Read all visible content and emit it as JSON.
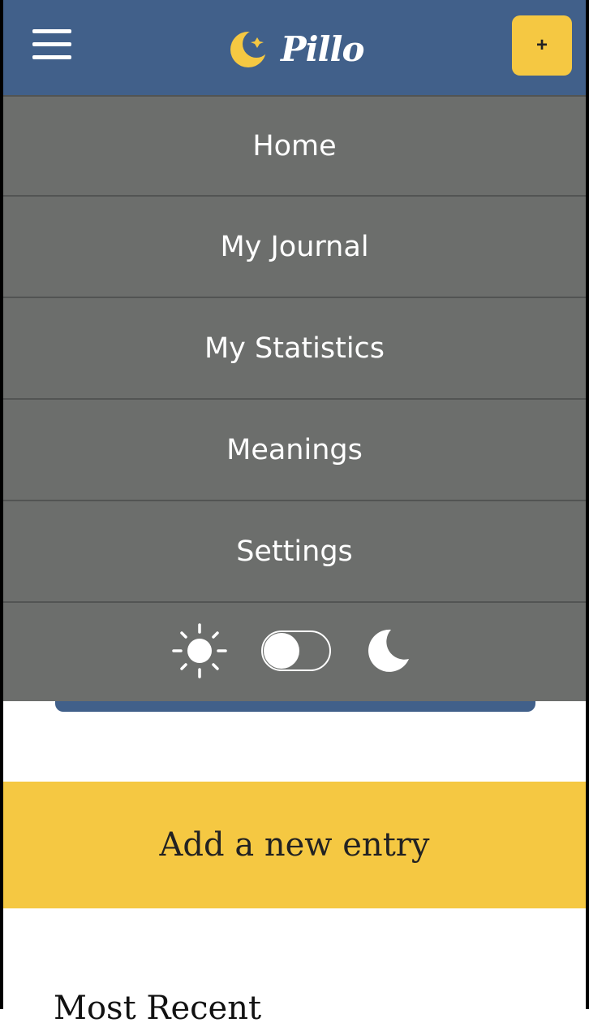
{
  "header": {
    "logo_text": "Pillo",
    "add_label": "+",
    "colors": {
      "bar": "#41608a",
      "accent": "#f5c842"
    },
    "icons": {
      "menu": "hamburger-menu-icon",
      "logo": "moon-star-logo-icon"
    }
  },
  "menu": {
    "items": [
      {
        "label": "Home"
      },
      {
        "label": "My Journal"
      },
      {
        "label": "My Statistics"
      },
      {
        "label": "Meanings"
      },
      {
        "label": "Settings"
      }
    ],
    "theme": {
      "light_icon": "sun-icon",
      "dark_icon": "moon-icon",
      "dark_mode_on": false
    },
    "background": "#6c6e6c"
  },
  "main": {
    "add_entry_label": "Add a new entry",
    "most_recent_label": "Most Recent"
  }
}
